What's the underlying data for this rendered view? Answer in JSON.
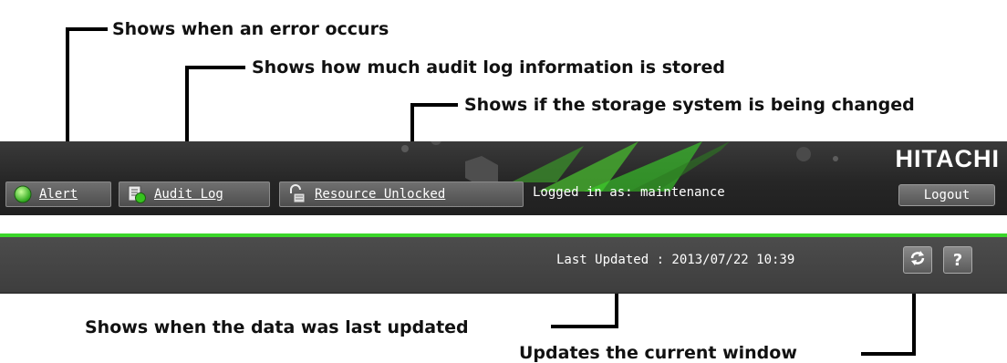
{
  "callouts": {
    "alert": "Shows when an error occurs",
    "audit_log": "Shows how much audit log information is stored",
    "resource": "Shows if the storage system is being changed",
    "last_updated": "Shows when the data was last updated",
    "refresh": "Updates the current window"
  },
  "header": {
    "brand": "HITACHI",
    "alert_label": "Alert",
    "audit_log_label": "Audit Log",
    "resource_label": "Resource Unlocked",
    "logged_in": "Logged in as: maintenance",
    "logout_label": "Logout"
  },
  "subheader": {
    "last_updated": "Last Updated : 2013/07/22 10:39",
    "help_label": "?"
  },
  "icons": {
    "alert": "green-status-icon",
    "audit_log": "audit-log-icon",
    "resource": "unlocked-padlock-icon",
    "refresh": "refresh-icon"
  },
  "colors": {
    "accent": "#3bd62a",
    "bar": "#2a2a2a"
  }
}
